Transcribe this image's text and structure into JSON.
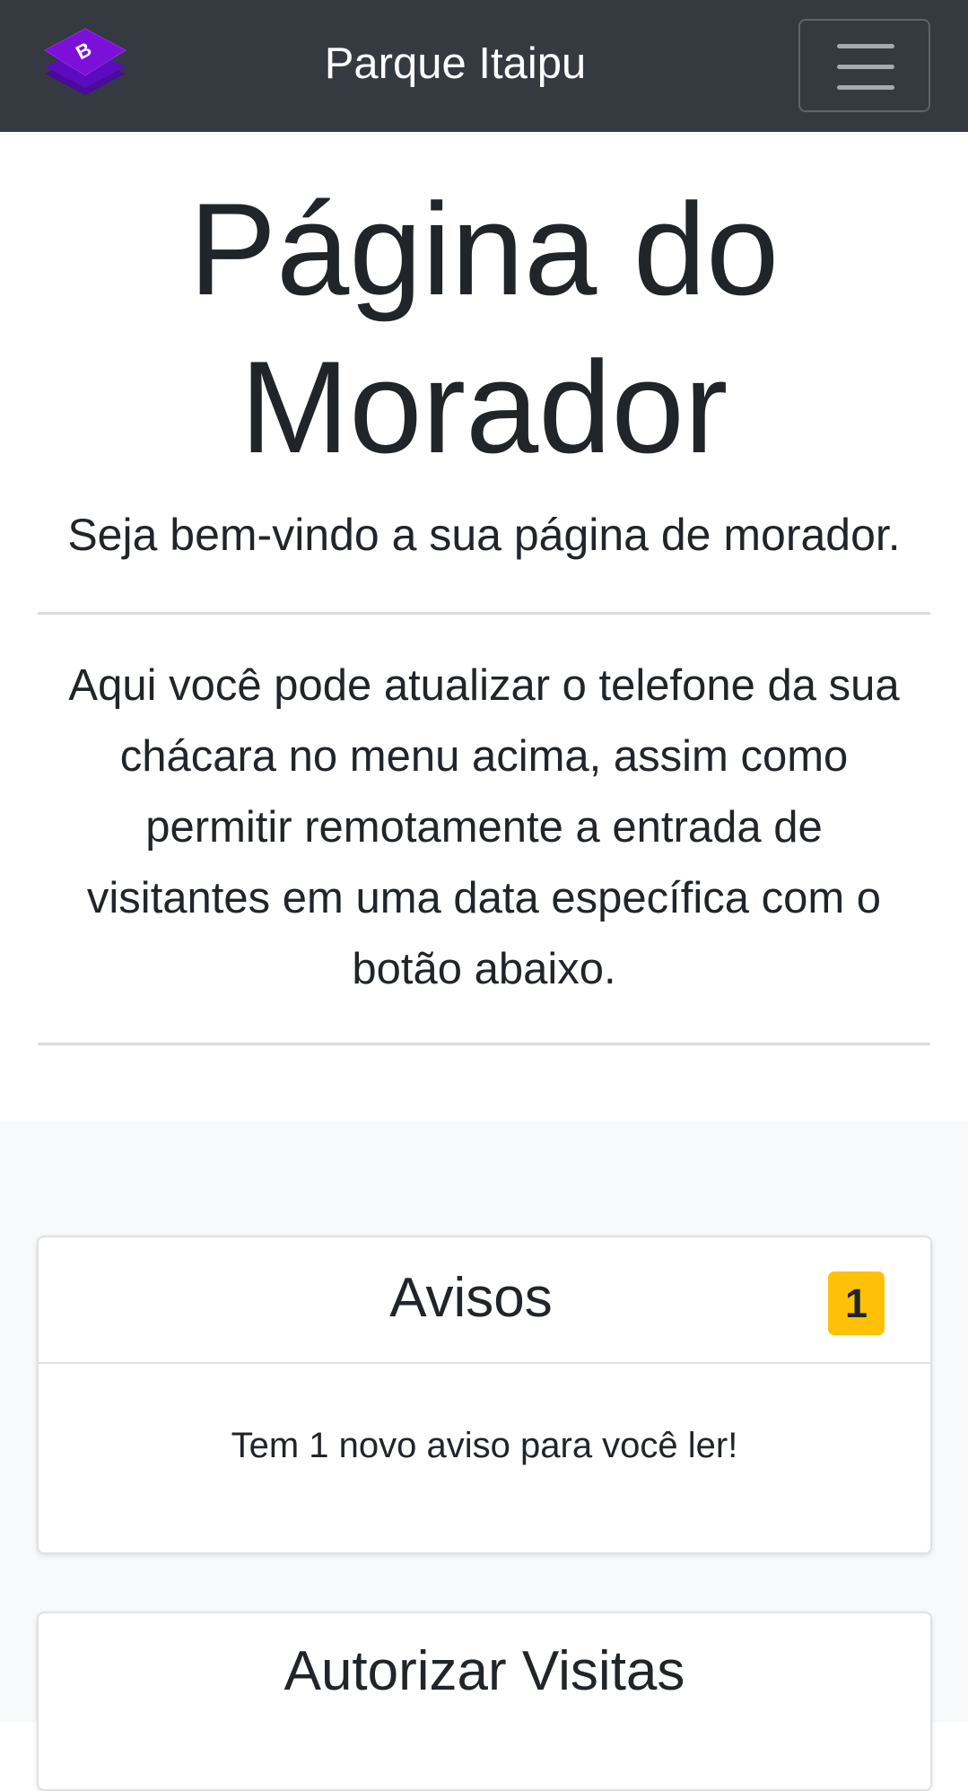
{
  "navbar": {
    "brand_title": "Parque Itaipu",
    "logo_letter": "B",
    "menu_toggle_icon": "hamburger-icon"
  },
  "hero": {
    "title_line1": "Página do",
    "title_line2": "Morador",
    "lead": "Seja bem-vindo a sua página de morador.",
    "text_lines": [
      "Aqui você pode atualizar o telefone da sua",
      "chácara no menu acima, assim como",
      "permitir remotamente a entrada de",
      "visitantes em uma data específica com o",
      "botão abaixo."
    ]
  },
  "cards": {
    "avisos": {
      "title": "Avisos",
      "badge_count": "1",
      "body": "Tem 1 novo aviso para você ler!"
    },
    "visitas": {
      "title": "Autorizar Visitas"
    }
  },
  "colors": {
    "navbar_bg": "#343a40",
    "badge_bg": "#ffc107",
    "section_bg": "#f8f9fa",
    "logo_purple": "#7b10d8"
  }
}
